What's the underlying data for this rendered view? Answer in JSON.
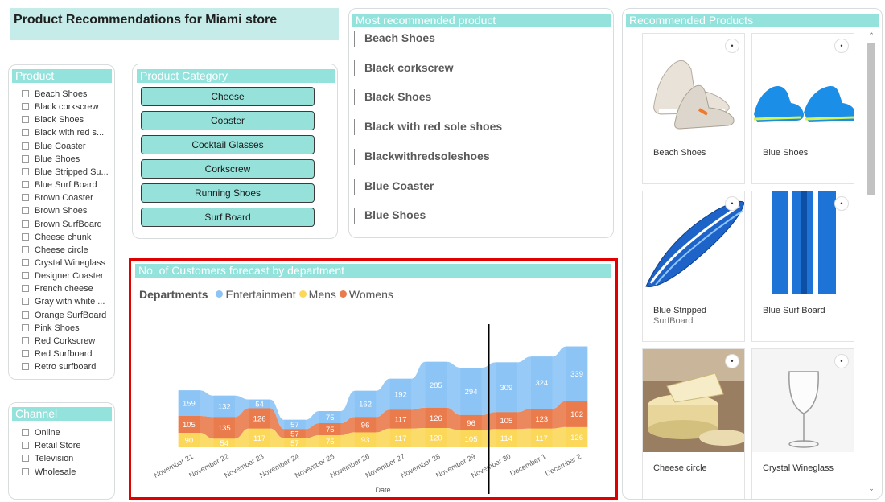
{
  "page_title": "Product Recommendations for Miami store",
  "product_slicer": {
    "header": "Product",
    "items": [
      "Beach Shoes",
      "Black corkscrew",
      "Black Shoes",
      "Black with red s...",
      "Blue Coaster",
      "Blue Shoes",
      "Blue Stripped Su...",
      "Blue Surf Board",
      "Brown Coaster",
      "Brown Shoes",
      "Brown SurfBoard",
      "Cheese chunk",
      "Cheese circle",
      "Crystal Wineglass",
      "Designer Coaster",
      "French cheese",
      "Gray with white ...",
      "Orange SurfBoard",
      "Pink Shoes",
      "Red Corkscrew",
      "Red Surfboard",
      "Retro surfboard"
    ]
  },
  "category_slicer": {
    "header": "Product Category",
    "buttons": [
      "Cheese",
      "Coaster",
      "Cocktail Glasses",
      "Corkscrew",
      "Running Shoes",
      "Surf Board"
    ]
  },
  "channel_slicer": {
    "header": "Channel",
    "items": [
      "Online",
      "Retail Store",
      "Television",
      "Wholesale"
    ]
  },
  "most_recommended": {
    "header": "Most recommended product",
    "items": [
      "Beach Shoes",
      "Black corkscrew",
      "Black Shoes",
      "Black with red sole shoes",
      "Blackwithredsoleshoes",
      "Blue Coaster",
      "Blue Shoes"
    ]
  },
  "recommended_products": {
    "header": "Recommended Products",
    "cards": [
      {
        "name": "Beach Shoes",
        "sub": "",
        "icon": "shoe-icon"
      },
      {
        "name": "Blue Shoes",
        "sub": "",
        "icon": "shoe-icon"
      },
      {
        "name": "Blue Stripped",
        "sub": "SurfBoard",
        "icon": "surfboard-icon"
      },
      {
        "name": "Blue Surf Board",
        "sub": "",
        "icon": "surfboard-icon"
      },
      {
        "name": "Cheese circle",
        "sub": "",
        "icon": "cheese-icon"
      },
      {
        "name": "Crystal Wineglass",
        "sub": "",
        "icon": "wineglass-icon"
      }
    ]
  },
  "forecast_chart": {
    "header": "No. of Customers forecast by department",
    "legend_title": "Departments",
    "colors": {
      "Entertainment": "#8cc4f5",
      "Mens": "#fbd75a",
      "Womens": "#ea7b4d"
    }
  },
  "chart_data": {
    "type": "area",
    "title": "No. of Customers forecast by department",
    "xlabel": "Date",
    "ylabel": "",
    "categories": [
      "November 21",
      "November 22",
      "November 23",
      "November 24",
      "November 25",
      "November 26",
      "November 27",
      "November 28",
      "November 29",
      "November 30",
      "December 1",
      "December 2"
    ],
    "series": [
      {
        "name": "Mens",
        "values": [
          90,
          54,
          117,
          57,
          75,
          93,
          117,
          120,
          105,
          114,
          117,
          126
        ]
      },
      {
        "name": "Womens",
        "values": [
          105,
          135,
          126,
          57,
          75,
          96,
          117,
          126,
          96,
          105,
          123,
          162
        ]
      },
      {
        "name": "Entertainment",
        "values": [
          159,
          132,
          54,
          57,
          75,
          162,
          192,
          285,
          294,
          309,
          324,
          339
        ]
      }
    ],
    "stacked_order": [
      "Mens",
      "Womens",
      "Entertainment"
    ],
    "legend": "top-left",
    "forecast_start": "November 29"
  }
}
